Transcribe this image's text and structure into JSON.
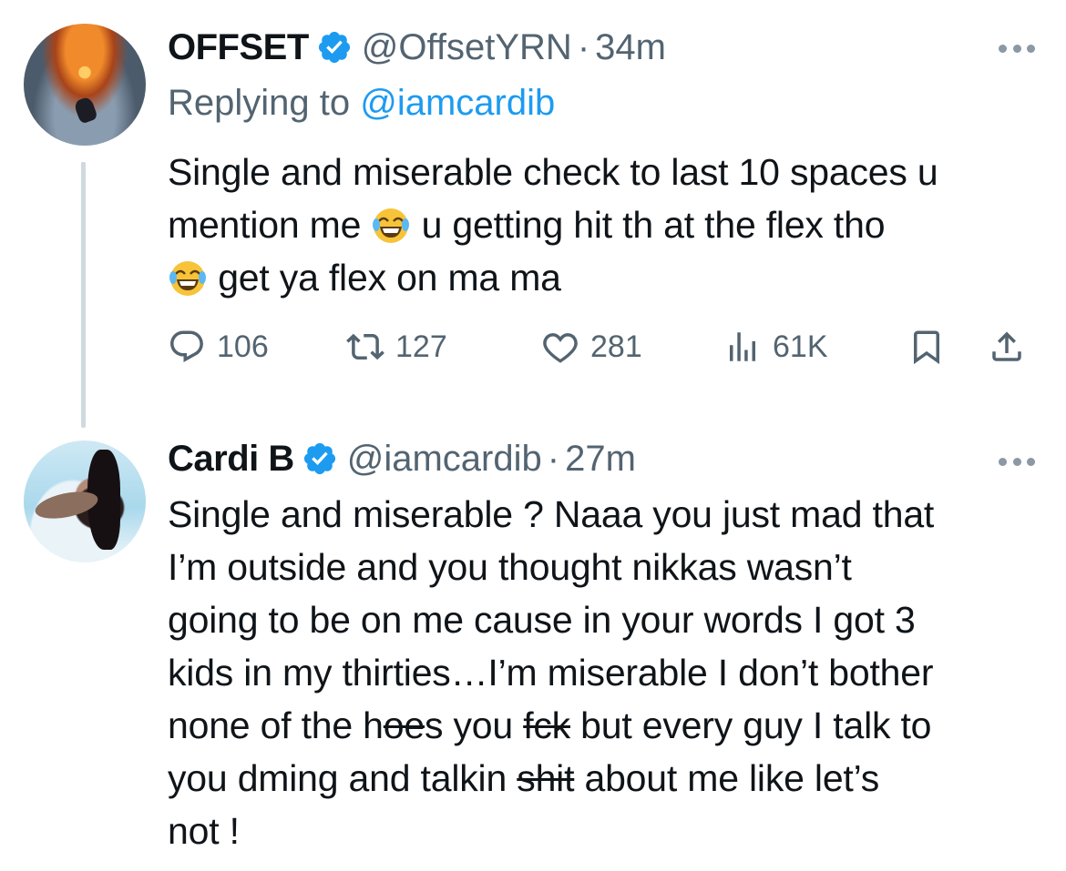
{
  "tweets": [
    {
      "display_name": "OFFSET",
      "handle": "@OffsetYRN",
      "separator": "·",
      "time": "34m",
      "replying_prefix": "Replying to ",
      "replying_to": "@iamcardib",
      "body": {
        "l1": "Single and miserable check to last 10 spaces u",
        "l2a": "mention me ",
        "l2b": " u getting hit th at the flex tho",
        "l3": " get ya flex on ma ma"
      },
      "emoji": "face-with-tears-of-joy",
      "stats": {
        "replies": "106",
        "retweets": "127",
        "likes": "281",
        "views": "61K"
      }
    },
    {
      "display_name": "Cardi B",
      "handle": "@iamcardib",
      "separator": "·",
      "time": "27m",
      "body": {
        "l1": "Single and miserable ? Naaa you just mad that",
        "l2": "I’m outside and you thought nikkas wasn’t",
        "l3": "going to be on me cause in your words I got 3",
        "l4": "kids in my thirties…I’m miserable I don’t bother",
        "l5a": "none of the h",
        "l5b": "oe",
        "l5c": "s you ",
        "l5d": "fck",
        "l5e": " but every guy I talk to",
        "l6a": "you dming and talkin ",
        "l6b": "shit",
        "l6c": " about me like let’s",
        "l7": "not !"
      }
    }
  ],
  "colors": {
    "text": "#0f1419",
    "secondary": "#536471",
    "accent": "#1d9bf0",
    "thread_line": "#cfd9de"
  },
  "icons": [
    "verified-badge-icon",
    "more-options-icon",
    "reply-icon",
    "retweet-icon",
    "like-icon",
    "views-icon",
    "bookmark-icon",
    "share-icon"
  ]
}
